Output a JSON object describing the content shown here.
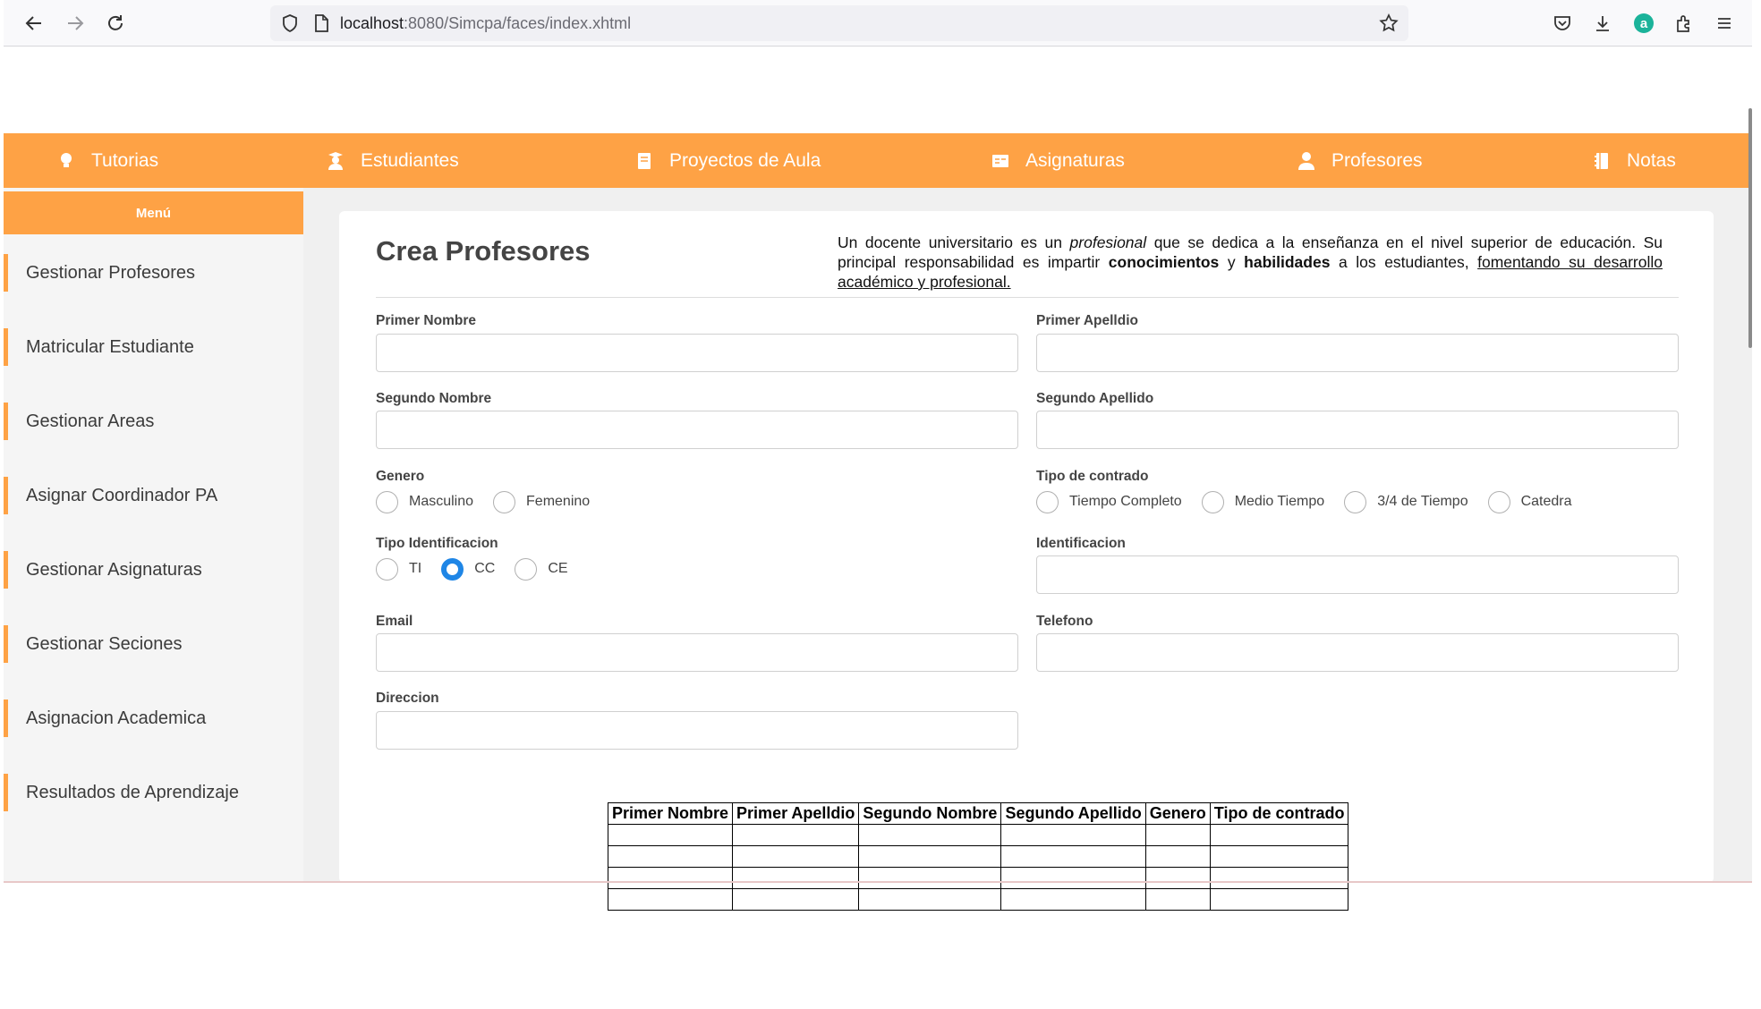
{
  "browser": {
    "url_host": "localhost",
    "url_path": ":8080/Simcpa/faces/index.xhtml"
  },
  "topnav": {
    "items": [
      {
        "label": "Tutorias",
        "icon": "lightbulb-icon"
      },
      {
        "label": "Estudiantes",
        "icon": "student-icon"
      },
      {
        "label": "Proyectos de Aula",
        "icon": "book-icon"
      },
      {
        "label": "Asignaturas",
        "icon": "card-icon"
      },
      {
        "label": "Profesores",
        "icon": "teacher-icon"
      },
      {
        "label": "Notas",
        "icon": "notebook-icon"
      }
    ]
  },
  "sidebar": {
    "header": "Menú",
    "items": [
      {
        "label": "Gestionar Profesores"
      },
      {
        "label": "Matricular Estudiante"
      },
      {
        "label": "Gestionar Areas"
      },
      {
        "label": "Asignar Coordinador PA"
      },
      {
        "label": "Gestionar Asignaturas"
      },
      {
        "label": "Gestionar Seciones"
      },
      {
        "label": "Asignacion Academica"
      },
      {
        "label": "Resultados de Aprendizaje"
      }
    ]
  },
  "form": {
    "title": "Crea Profesores",
    "description": {
      "p1": "Un docente universitario es un ",
      "em": "profesional",
      "p2": " que se dedica a la enseñanza en el nivel superior de educación. Su principal responsabilidad es impartir ",
      "b1": "conocimientos",
      "p3": " y ",
      "b2": "habilidades",
      "p4": " a los estudiantes, ",
      "u": "fomentando su desarrollo académico y profesional."
    },
    "fields": {
      "primer_nombre": {
        "label": "Primer Nombre",
        "value": ""
      },
      "primer_apellido": {
        "label": "Primer Apelldio",
        "value": ""
      },
      "segundo_nombre": {
        "label": "Segundo Nombre",
        "value": ""
      },
      "segundo_apellido": {
        "label": "Segundo Apellido",
        "value": ""
      },
      "identificacion": {
        "label": "Identificacion",
        "value": ""
      },
      "email": {
        "label": "Email",
        "value": ""
      },
      "telefono": {
        "label": "Telefono",
        "value": ""
      },
      "direccion": {
        "label": "Direccion",
        "value": ""
      }
    },
    "genero": {
      "label": "Genero",
      "options": [
        "Masculino",
        "Femenino"
      ],
      "selected": null
    },
    "tipo_contrado": {
      "label": "Tipo de contrado",
      "options": [
        "Tiempo Completo",
        "Medio Tiempo",
        "3/4 de Tiempo",
        "Catedra"
      ],
      "selected": null
    },
    "tipo_identificacion": {
      "label": "Tipo Identificacion",
      "options": [
        "TI",
        "CC",
        "CE"
      ],
      "selected": "CC"
    }
  },
  "table": {
    "headers": [
      "Primer Nombre",
      "Primer Apelldio",
      "Segundo Nombre",
      "Segundo Apellido",
      "Genero",
      "Tipo de contrado"
    ],
    "rows": [
      [
        "",
        "",
        "",
        "",
        "",
        ""
      ],
      [
        "",
        "",
        "",
        "",
        "",
        ""
      ],
      [
        "",
        "",
        "",
        "",
        "",
        ""
      ],
      [
        "",
        "",
        "",
        "",
        "",
        ""
      ]
    ]
  },
  "colors": {
    "accent": "#fea245",
    "radio_selected": "#1f86e6"
  }
}
